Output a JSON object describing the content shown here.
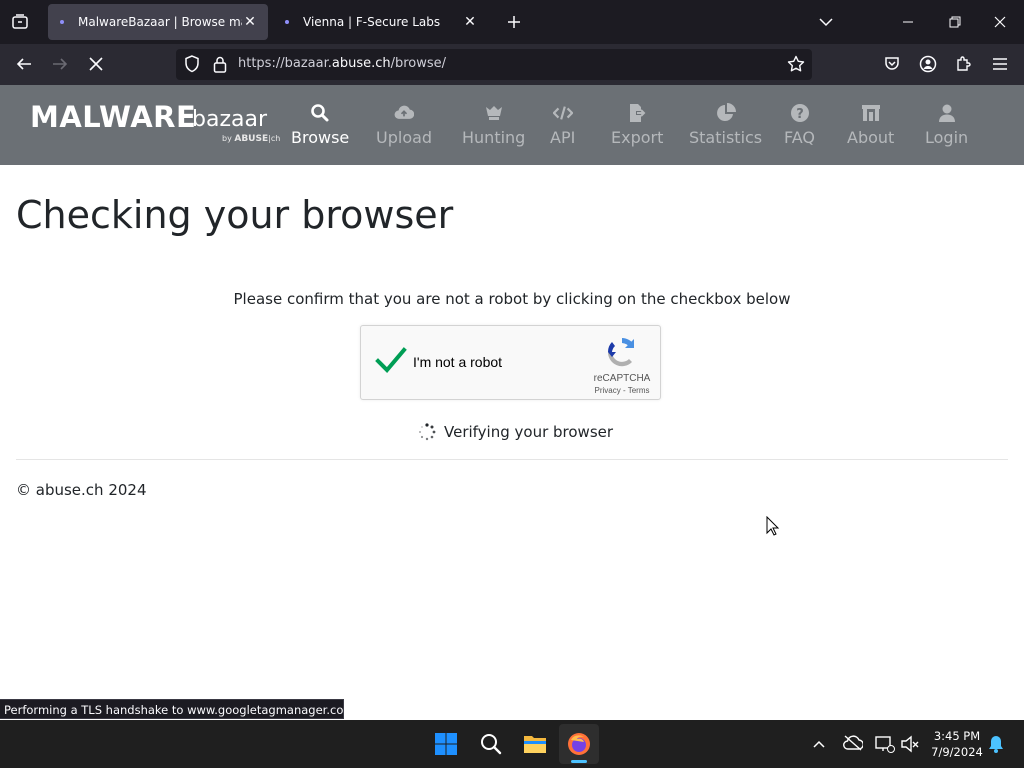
{
  "browser": {
    "tabs": [
      {
        "title": "MalwareBazaar | Browse malwa",
        "active": true
      },
      {
        "title": "Vienna | F-Secure Labs",
        "active": false
      }
    ],
    "url_prefix": "https://bazaar.",
    "url_domain": "abuse.ch",
    "url_path": "/browse/",
    "status_text": "Performing a TLS handshake to www.googletagmanager.com..."
  },
  "site": {
    "logo_main": "MALWARE",
    "logo_sub": "bazaar",
    "logo_by": "by",
    "logo_abuse": "ABUSE",
    "logo_ch": "|ch",
    "nav": [
      {
        "label": "Browse",
        "icon": "search-icon",
        "active": true
      },
      {
        "label": "Upload",
        "icon": "cloud-upload-icon",
        "active": false
      },
      {
        "label": "Hunting",
        "icon": "hunting-icon",
        "active": false
      },
      {
        "label": "API",
        "icon": "code-icon",
        "active": false
      },
      {
        "label": "Export",
        "icon": "file-export-icon",
        "active": false
      },
      {
        "label": "Statistics",
        "icon": "pie-chart-icon",
        "active": false
      },
      {
        "label": "FAQ",
        "icon": "question-icon",
        "active": false
      },
      {
        "label": "About",
        "icon": "building-icon",
        "active": false
      },
      {
        "label": "Login",
        "icon": "user-icon",
        "active": false
      }
    ]
  },
  "content": {
    "title": "Checking your browser",
    "instruction": "Please confirm that you are not a robot by clicking on the checkbox below",
    "recaptcha": {
      "label": "I'm not a robot",
      "brand": "reCAPTCHA",
      "links": "Privacy - Terms",
      "checked": true,
      "check_color": "#009e55"
    },
    "verifying": "Verifying your browser",
    "footer": "© abuse.ch 2024"
  },
  "taskbar": {
    "time": "3:45 PM",
    "date": "7/9/2024"
  },
  "colors": {
    "header_bg": "#6b7075",
    "tab_bar": "#1c1b22",
    "nav_bar": "#2b2a33"
  }
}
